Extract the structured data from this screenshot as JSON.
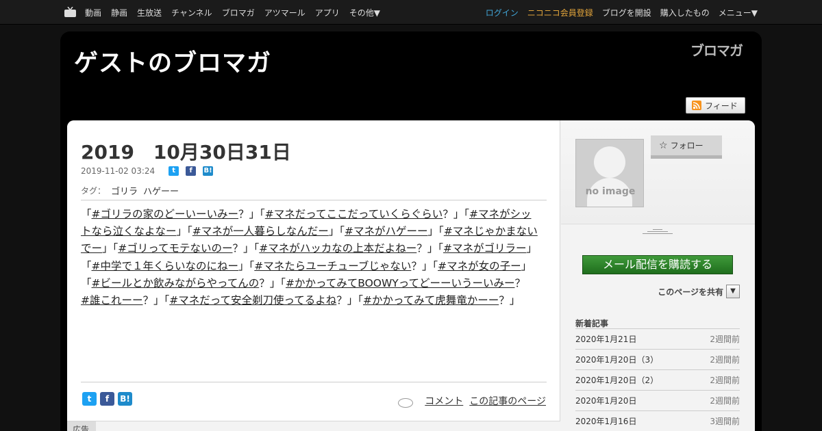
{
  "topnav": {
    "left_items": [
      "動画",
      "静画",
      "生放送",
      "チャンネル",
      "ブロマガ",
      "アツマール",
      "アプリ",
      "その他▼"
    ],
    "login": "ログイン",
    "register": "ニコニコ会員登録",
    "open_blog": "ブログを開設",
    "purchased": "購入したもの",
    "menu": "メニュー▼"
  },
  "blog": {
    "title": "ゲストのブロマガ",
    "logo_text": "ブロマガ",
    "feed_label": "フィード"
  },
  "article": {
    "title": "2019　10月30日31日",
    "date": "2019-11-02 03:24",
    "tags_label": "タグ：",
    "tags": [
      "ゴリラ",
      "ハゲーー"
    ],
    "body": [
      {
        "t": "「"
      },
      {
        "l": "#ゴリラの家のどーいーいみー"
      },
      {
        "t": "？」「"
      },
      {
        "l": "#マネだってここだっていくらぐらい"
      },
      {
        "t": "？」「"
      },
      {
        "l": "#マネがシットなら泣くなよなー"
      },
      {
        "t": "」「"
      },
      {
        "l": "#マネが一人暮らしなんだー"
      },
      {
        "t": "」「"
      },
      {
        "l": "#マネがハゲーー"
      },
      {
        "t": "」「"
      },
      {
        "l": "#マネじゃかまないでー"
      },
      {
        "t": "」「"
      },
      {
        "l": "#ゴリってモテないのー"
      },
      {
        "t": "？」「"
      },
      {
        "l": "#マネがハッカなの上本だよねー"
      },
      {
        "t": "？」「"
      },
      {
        "l": "#マネがゴリラー"
      },
      {
        "t": "」「"
      },
      {
        "l": "#中学で１年くらいなのにねー"
      },
      {
        "t": "」「"
      },
      {
        "l": "#マネたらユーチューブじゃない"
      },
      {
        "t": "？」「"
      },
      {
        "l": "#マネが女の子ー"
      },
      {
        "t": "」「"
      },
      {
        "l": "#ビールとか飲みながらやってんの"
      },
      {
        "t": "？」「"
      },
      {
        "l": "#かかってみてBOOWYってどーーいうーいみー"
      },
      {
        "t": "？　"
      },
      {
        "l": "#誰これーー"
      },
      {
        "t": "？」「"
      },
      {
        "l": "#マネだって安全剃刀使ってるよね"
      },
      {
        "t": "？」「"
      },
      {
        "l": "#かかってみて虎舞竜かーー"
      },
      {
        "t": "？」"
      }
    ],
    "comment_link": "コメント",
    "permalink": "この記事のページ",
    "ad_label": "広告"
  },
  "sidebar": {
    "no_image": "no image",
    "follow_label": "フォロー",
    "subscribe_label": "メール配信を購読する",
    "share_page_label": "このページを共有",
    "recent_heading": "新着記事",
    "recent": [
      {
        "title": "2020年1月21日",
        "ago": "2週間前"
      },
      {
        "title": "2020年1月20日（3）",
        "ago": "2週間前"
      },
      {
        "title": "2020年1月20日（2）",
        "ago": "2週間前"
      },
      {
        "title": "2020年1月20日",
        "ago": "2週間前"
      },
      {
        "title": "2020年1月16日",
        "ago": "3週間前"
      }
    ]
  },
  "colors": {
    "login": "#41a6d8",
    "register": "#e3a53b",
    "subscribe": "#2d8428",
    "twitter": "#1da1f2",
    "facebook": "#3b5998",
    "hatena": "#1e8bcb"
  }
}
